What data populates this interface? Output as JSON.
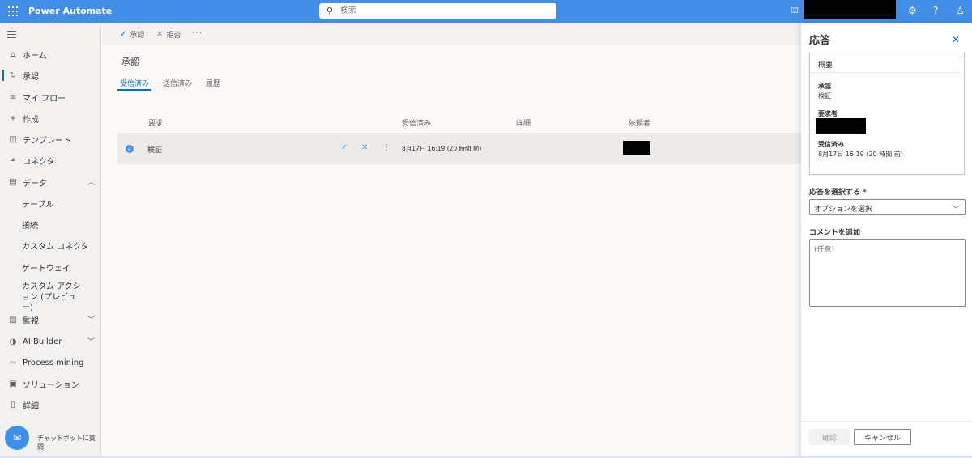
{
  "header": {
    "app_title": "Power Automate",
    "search_placeholder": "検索"
  },
  "nav": {
    "items": [
      {
        "label": "ホーム"
      },
      {
        "label": "承認"
      },
      {
        "label": "マイ フロー"
      },
      {
        "label": "作成"
      },
      {
        "label": "テンプレート"
      },
      {
        "label": "コネクタ"
      },
      {
        "label": "データ"
      },
      {
        "label": "テーブル"
      },
      {
        "label": "接続"
      },
      {
        "label": "カスタム コネクタ"
      },
      {
        "label": "ゲートウェイ"
      },
      {
        "label": "カスタム アクション (プレビュー)"
      },
      {
        "label": "監視"
      },
      {
        "label": "AI Builder"
      },
      {
        "label": "Process mining"
      },
      {
        "label": "ソリューション"
      },
      {
        "label": "詳細"
      }
    ],
    "chatbot_label": "チャットボットに質問"
  },
  "commands": {
    "approve": "承認",
    "reject": "拒否",
    "more": "···"
  },
  "main": {
    "title": "承認",
    "tabs": [
      {
        "label": "受信済み"
      },
      {
        "label": "送信済み"
      },
      {
        "label": "履歴"
      }
    ],
    "columns": [
      "要求",
      "受信済み",
      "詳細",
      "依頼者"
    ],
    "rows": [
      {
        "request": "検証",
        "received": "8月17日 16:19 (20 時間 前)"
      }
    ]
  },
  "panel": {
    "title": "応答",
    "summary_heading": "概要",
    "approval_label": "承認",
    "approval_value": "検証",
    "requester_label": "要求者",
    "received_label": "受信済み",
    "received_value": "8月17日 16:19 (20 時間 前)",
    "response_label": "応答を選択する",
    "required_mark": "*",
    "response_placeholder": "オプションを選択",
    "comment_label": "コメントを追加",
    "comment_placeholder": "(任意)",
    "confirm_button": "確認",
    "cancel_button": "キャンセル"
  }
}
